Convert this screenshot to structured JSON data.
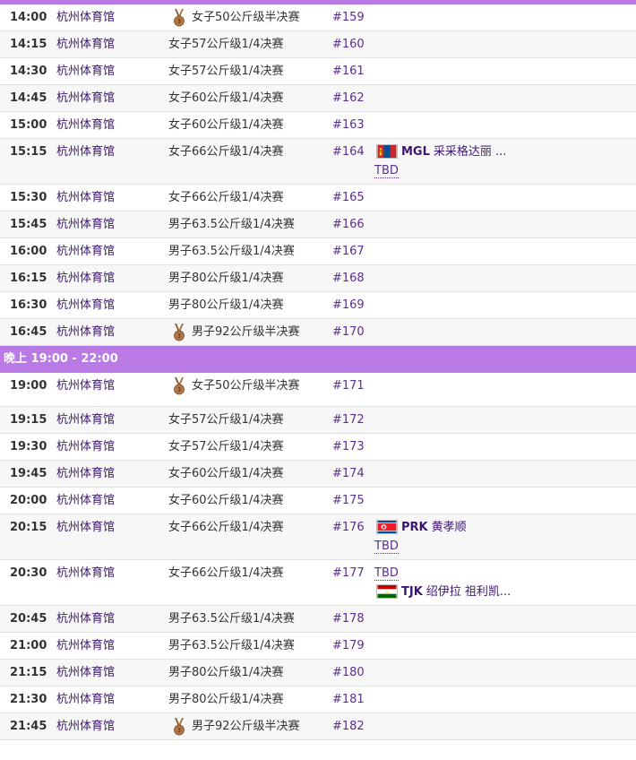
{
  "section_label": "晚上 19:00 - 22:00",
  "rows": [
    {
      "time": "14:00",
      "venue": "杭州体育馆",
      "event": "女子50公斤级半决赛",
      "match": "#159",
      "medal": true
    },
    {
      "time": "14:15",
      "venue": "杭州体育馆",
      "event": "女子57公斤级1/4决赛",
      "match": "#160"
    },
    {
      "time": "14:30",
      "venue": "杭州体育馆",
      "event": "女子57公斤级1/4决赛",
      "match": "#161"
    },
    {
      "time": "14:45",
      "venue": "杭州体育馆",
      "event": "女子60公斤级1/4决赛",
      "match": "#162"
    },
    {
      "time": "15:00",
      "venue": "杭州体育馆",
      "event": "女子60公斤级1/4决赛",
      "match": "#163"
    },
    {
      "time": "15:15",
      "venue": "杭州体育馆",
      "event": "女子66公斤级1/4决赛",
      "match": "#164",
      "participants": [
        {
          "flag": "mgl",
          "code": "MGL",
          "name": "采采格达丽 ..."
        },
        {
          "tbd": "TBD"
        }
      ]
    },
    {
      "time": "15:30",
      "venue": "杭州体育馆",
      "event": "女子66公斤级1/4决赛",
      "match": "#165"
    },
    {
      "time": "15:45",
      "venue": "杭州体育馆",
      "event": "男子63.5公斤级1/4决赛",
      "match": "#166"
    },
    {
      "time": "16:00",
      "venue": "杭州体育馆",
      "event": "男子63.5公斤级1/4决赛",
      "match": "#167"
    },
    {
      "time": "16:15",
      "venue": "杭州体育馆",
      "event": "男子80公斤级1/4决赛",
      "match": "#168"
    },
    {
      "time": "16:30",
      "venue": "杭州体育馆",
      "event": "男子80公斤级1/4决赛",
      "match": "#169"
    },
    {
      "time": "16:45",
      "venue": "杭州体育馆",
      "event": "男子92公斤级半决赛",
      "match": "#170",
      "medal": true
    },
    {
      "section": true
    },
    {
      "time": "19:00",
      "venue": "杭州体育馆",
      "event": "女子50公斤级半决赛",
      "match": "#171",
      "medal": true
    },
    {
      "time": "19:15",
      "venue": "杭州体育馆",
      "event": "女子57公斤级1/4决赛",
      "match": "#172"
    },
    {
      "time": "19:30",
      "venue": "杭州体育馆",
      "event": "女子57公斤级1/4决赛",
      "match": "#173"
    },
    {
      "time": "19:45",
      "venue": "杭州体育馆",
      "event": "女子60公斤级1/4决赛",
      "match": "#174"
    },
    {
      "time": "20:00",
      "venue": "杭州体育馆",
      "event": "女子60公斤级1/4决赛",
      "match": "#175"
    },
    {
      "time": "20:15",
      "venue": "杭州体育馆",
      "event": "女子66公斤级1/4决赛",
      "match": "#176",
      "participants": [
        {
          "flag": "prk",
          "code": "PRK",
          "name": "黄孝顺"
        },
        {
          "tbd": "TBD"
        }
      ]
    },
    {
      "time": "20:30",
      "venue": "杭州体育馆",
      "event": "女子66公斤级1/4决赛",
      "match": "#177",
      "participants": [
        {
          "tbd": "TBD"
        },
        {
          "flag": "tjk",
          "code": "TJK",
          "name": "绍伊拉 祖利凯..."
        }
      ]
    },
    {
      "time": "20:45",
      "venue": "杭州体育馆",
      "event": "男子63.5公斤级1/4决赛",
      "match": "#178"
    },
    {
      "time": "21:00",
      "venue": "杭州体育馆",
      "event": "男子63.5公斤级1/4决赛",
      "match": "#179"
    },
    {
      "time": "21:15",
      "venue": "杭州体育馆",
      "event": "男子80公斤级1/4决赛",
      "match": "#180"
    },
    {
      "time": "21:30",
      "venue": "杭州体育馆",
      "event": "男子80公斤级1/4决赛",
      "match": "#181"
    },
    {
      "time": "21:45",
      "venue": "杭州体育馆",
      "event": "男子92公斤级半决赛",
      "match": "#182",
      "medal": true
    }
  ]
}
